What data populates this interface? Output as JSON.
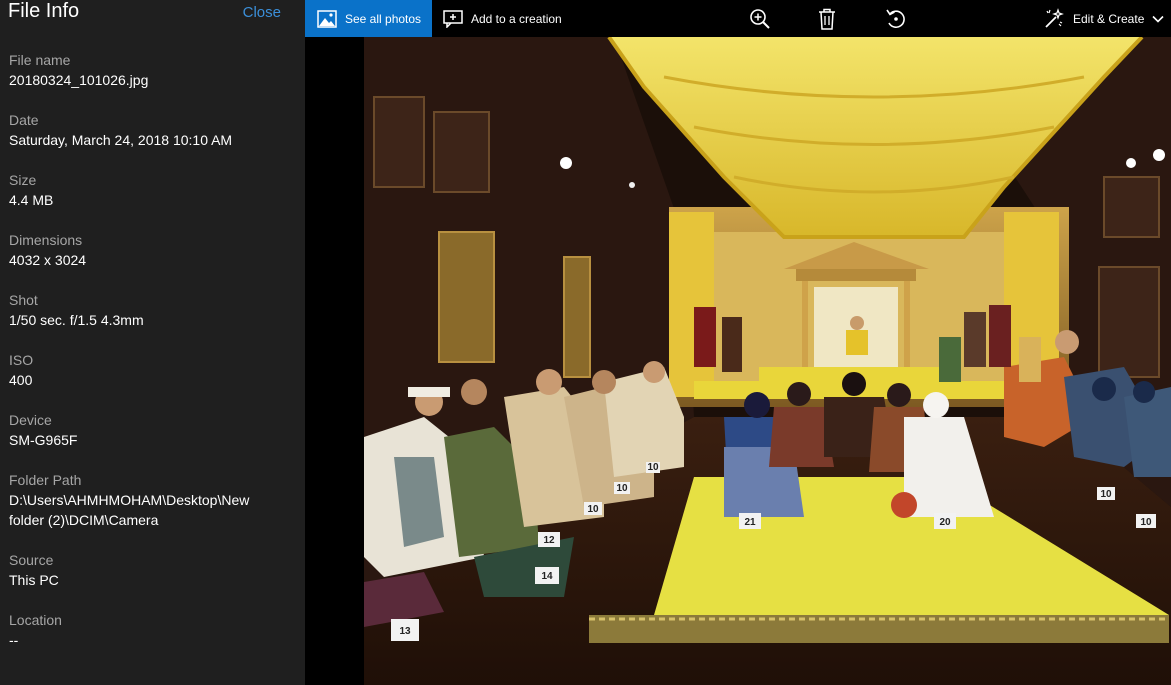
{
  "panel": {
    "title": "File Info",
    "close_label": "Close",
    "fields": [
      {
        "label": "File name",
        "value": "20180324_101026.jpg"
      },
      {
        "label": "Date",
        "value": "Saturday, March 24, 2018 10:10 AM"
      },
      {
        "label": "Size",
        "value": "4.4 MB"
      },
      {
        "label": "Dimensions",
        "value": "4032 x 3024"
      },
      {
        "label": "Shot",
        "value": "1/50 sec. f/1.5 4.3mm"
      },
      {
        "label": "ISO",
        "value": "400"
      },
      {
        "label": "Device",
        "value": "SM-G965F"
      },
      {
        "label": "Folder Path",
        "value": "D:\\Users\\AHMHMOHAM\\Desktop\\New\nfolder (2)\\DCIM\\Camera"
      },
      {
        "label": "Source",
        "value": "This PC"
      },
      {
        "label": "Location",
        "value": "--"
      }
    ]
  },
  "toolbar": {
    "see_all_label": "See all photos",
    "add_creation_label": "Add to a creation",
    "edit_create_label": "Edit & Create",
    "icons": {
      "see_all": "photos-icon",
      "add_creation": "add-creation-icon",
      "zoom": "zoom-in-icon",
      "delete": "trash-icon",
      "rotate": "rotate-icon",
      "edit": "edit-wand-icon",
      "dropdown": "chevron-down-icon"
    },
    "accent_color": "#0a72c9"
  },
  "photo": {
    "placard_numbers": [
      "13",
      "14",
      "12",
      "10",
      "10",
      "10",
      "21",
      "20",
      "10",
      "10"
    ]
  }
}
